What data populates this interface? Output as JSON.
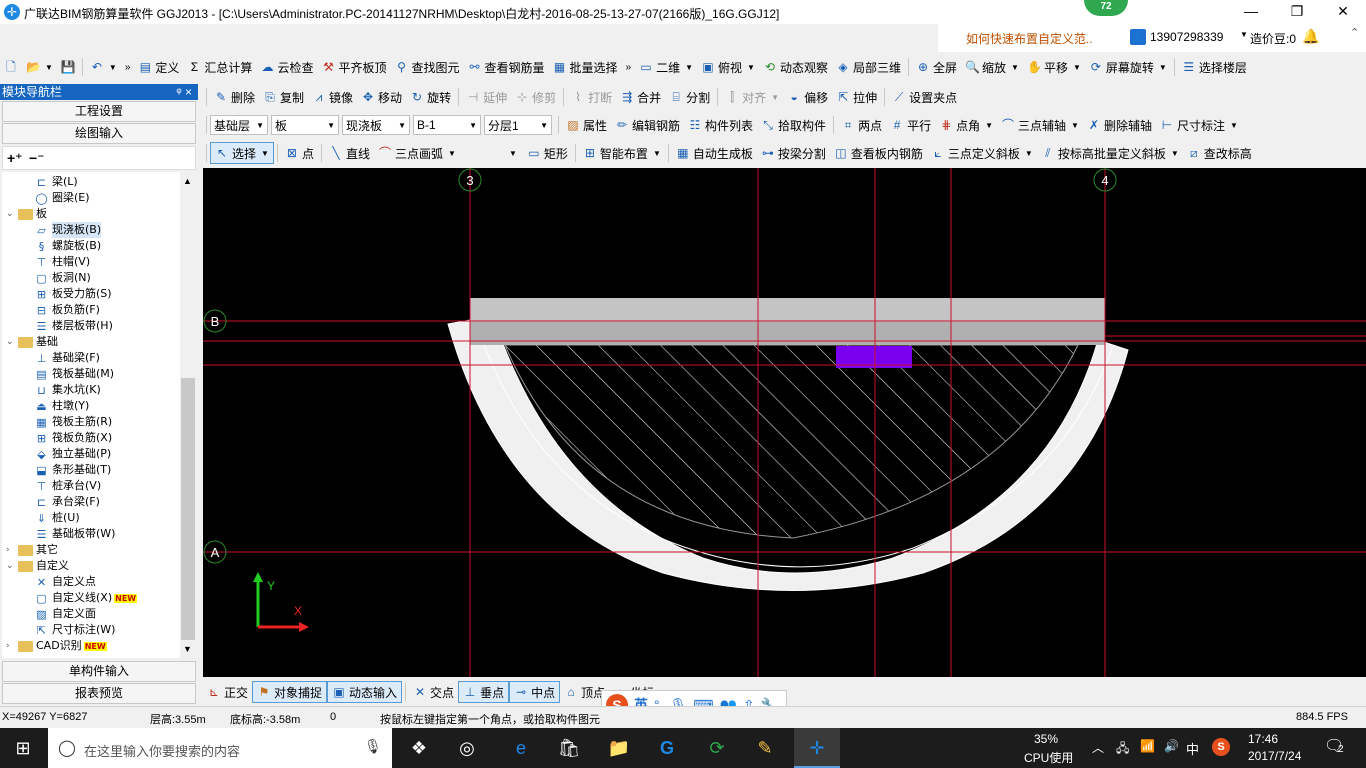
{
  "window": {
    "title": "广联达BIM钢筋算量软件 GGJ2013 - [C:\\Users\\Administrator.PC-20141127NRHM\\Desktop\\白龙村-2016-08-25-13-27-07(2166版)_16G.GGJ12]",
    "badge": "72",
    "controls": {
      "minimize": "—",
      "maximize": "❐",
      "close": "✕"
    }
  },
  "infobar": {
    "question": "如何快速布置自定义范..",
    "user": "13907298339",
    "beans": "造价豆:0"
  },
  "toolbar1": {
    "items": [
      "定义",
      "汇总计算",
      "云检查",
      "平齐板顶",
      "查找图元",
      "查看钢筋量",
      "批量选择"
    ],
    "view_items": [
      "二维",
      "俯视",
      "动态观察",
      "局部三维",
      "全屏",
      "缩放",
      "平移",
      "屏幕旋转",
      "选择楼层"
    ]
  },
  "toolbar2": {
    "items": [
      "删除",
      "复制",
      "镜像",
      "移动",
      "旋转",
      "延伸",
      "修剪",
      "打断",
      "合并",
      "分割",
      "对齐",
      "偏移",
      "拉伸",
      "设置夹点"
    ]
  },
  "toolbar3": {
    "combos": [
      "基础层",
      "板",
      "现浇板",
      "B-1",
      "分层1"
    ],
    "items": [
      "属性",
      "编辑钢筋",
      "构件列表",
      "拾取构件",
      "两点",
      "平行",
      "点角",
      "三点辅轴",
      "删除辅轴",
      "尺寸标注"
    ]
  },
  "toolbar4": {
    "items": [
      "选择",
      "点",
      "直线",
      "三点画弧",
      "矩形",
      "智能布置",
      "自动生成板",
      "按梁分割",
      "查看板内钢筋",
      "三点定义斜板",
      "按标高批量定义斜板",
      "查改标高"
    ]
  },
  "panel": {
    "title": "模块导航栏",
    "pin": "ᵠ ×",
    "btn_settings": "工程设置",
    "btn_drawing": "绘图输入",
    "btn_single": "单构件输入",
    "btn_report": "报表预览",
    "tree": [
      {
        "label": "梁(L)",
        "icon": "beam-icon",
        "level": 2
      },
      {
        "label": "圈梁(E)",
        "icon": "ring-beam-icon",
        "level": 2
      },
      {
        "label": "板",
        "icon": "folder-icon",
        "level": 1,
        "expanded": true
      },
      {
        "label": "现浇板(B)",
        "icon": "slab-icon",
        "level": 2,
        "selected": true
      },
      {
        "label": "螺旋板(B)",
        "icon": "spiral-slab-icon",
        "level": 2
      },
      {
        "label": "柱帽(V)",
        "icon": "column-cap-icon",
        "level": 2
      },
      {
        "label": "板洞(N)",
        "icon": "slab-hole-icon",
        "level": 2
      },
      {
        "label": "板受力筋(S)",
        "icon": "slab-rebar-icon",
        "level": 2
      },
      {
        "label": "板负筋(F)",
        "icon": "neg-rebar-icon",
        "level": 2
      },
      {
        "label": "楼层板带(H)",
        "icon": "floor-strip-icon",
        "level": 2
      },
      {
        "label": "基础",
        "icon": "folder-icon",
        "level": 1,
        "expanded": true
      },
      {
        "label": "基础梁(F)",
        "icon": "foundation-beam-icon",
        "level": 2
      },
      {
        "label": "筏板基础(M)",
        "icon": "raft-icon",
        "level": 2
      },
      {
        "label": "集水坑(K)",
        "icon": "sump-icon",
        "level": 2
      },
      {
        "label": "柱墩(Y)",
        "icon": "pier-icon",
        "level": 2
      },
      {
        "label": "筏板主筋(R)",
        "icon": "raft-main-icon",
        "level": 2
      },
      {
        "label": "筏板负筋(X)",
        "icon": "raft-neg-icon",
        "level": 2
      },
      {
        "label": "独立基础(P)",
        "icon": "isolated-footing-icon",
        "level": 2
      },
      {
        "label": "条形基础(T)",
        "icon": "strip-footing-icon",
        "level": 2
      },
      {
        "label": "桩承台(V)",
        "icon": "pile-cap-icon",
        "level": 2
      },
      {
        "label": "承台梁(F)",
        "icon": "cap-beam-icon",
        "level": 2
      },
      {
        "label": "桩(U)",
        "icon": "pile-icon",
        "level": 2
      },
      {
        "label": "基础板带(W)",
        "icon": "foundation-strip-icon",
        "level": 2
      },
      {
        "label": "其它",
        "icon": "folder-icon",
        "level": 1,
        "expanded": false
      },
      {
        "label": "自定义",
        "icon": "folder-icon",
        "level": 1,
        "expanded": true
      },
      {
        "label": "自定义点",
        "icon": "custom-point-icon",
        "level": 2
      },
      {
        "label": "自定义线(X)",
        "icon": "custom-line-icon",
        "level": 2,
        "badge": "NEW"
      },
      {
        "label": "自定义面",
        "icon": "custom-area-icon",
        "level": 2
      },
      {
        "label": "尺寸标注(W)",
        "icon": "dimension-icon",
        "level": 2
      },
      {
        "label": "CAD识别",
        "icon": "folder-icon",
        "level": 1,
        "expanded": false,
        "badge": "NEW"
      }
    ]
  },
  "canvas": {
    "axis_labels": {
      "col3": "3",
      "col4": "4",
      "rowB": "B",
      "rowA": "A"
    },
    "ucs": {
      "y": "Y",
      "x": "X"
    },
    "colors": {
      "background": "#000000",
      "grid": "#c8102e",
      "slab": "#b0b0b0",
      "arc": "#f0f0f0",
      "purple": "#7b00f0"
    }
  },
  "snapbar": {
    "items": [
      "正交",
      "对象捕捉",
      "动态输入",
      "交点",
      "垂点",
      "中点",
      "顶点",
      "坐标"
    ]
  },
  "status": {
    "coords": "X=49267 Y=6827",
    "floor_height": "层高:3.55m",
    "bottom_elevation": "底标高:-3.58m",
    "zero": "0",
    "hint": "按鼠标左键指定第一个角点，或拾取构件图元",
    "fps": "884.5 FPS"
  },
  "taskbar": {
    "search_placeholder": "在这里输入你要搜索的内容",
    "cpu_percent": "35%",
    "cpu_label": "CPU使用",
    "ime_lang": "中",
    "time": "17:46",
    "date": "2017/7/24",
    "notifications": "2"
  },
  "ime": {
    "lang": "英"
  }
}
